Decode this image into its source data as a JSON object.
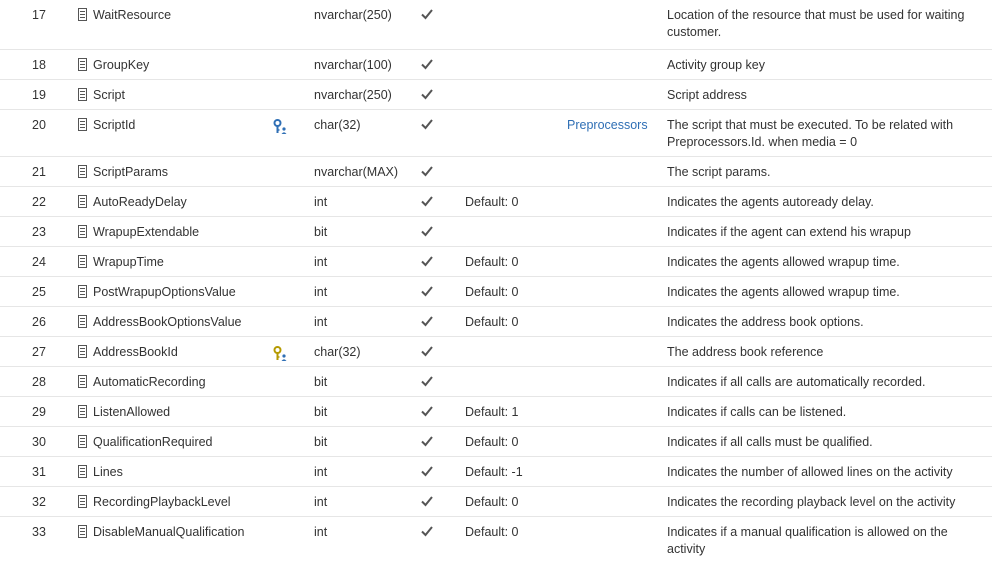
{
  "rows": [
    {
      "num": "17",
      "name": "WaitResource",
      "type": "nvarchar(250)",
      "nullable": true,
      "key": "",
      "default": "",
      "ref": "",
      "desc": "Location of the resource that must be used for waiting customer."
    },
    {
      "num": "18",
      "name": "GroupKey",
      "type": "nvarchar(100)",
      "nullable": true,
      "key": "",
      "default": "",
      "ref": "",
      "desc": "Activity group key"
    },
    {
      "num": "19",
      "name": "Script",
      "type": "nvarchar(250)",
      "nullable": true,
      "key": "",
      "default": "",
      "ref": "",
      "desc": "Script address"
    },
    {
      "num": "20",
      "name": "ScriptId",
      "type": "char(32)",
      "nullable": true,
      "key": "blue",
      "default": "",
      "ref": "Preprocessors",
      "desc": "The script that must be executed. To be related with Preprocessors.Id. when media = 0"
    },
    {
      "num": "21",
      "name": "ScriptParams",
      "type": "nvarchar(MAX)",
      "nullable": true,
      "key": "",
      "default": "",
      "ref": "",
      "desc": "The script params."
    },
    {
      "num": "22",
      "name": "AutoReadyDelay",
      "type": "int",
      "nullable": true,
      "key": "",
      "default": "Default: 0",
      "ref": "",
      "desc": "Indicates the agents autoready delay."
    },
    {
      "num": "23",
      "name": "WrapupExtendable",
      "type": "bit",
      "nullable": true,
      "key": "",
      "default": "",
      "ref": "",
      "desc": "Indicates if the agent can extend his wrapup"
    },
    {
      "num": "24",
      "name": "WrapupTime",
      "type": "int",
      "nullable": true,
      "key": "",
      "default": "Default: 0",
      "ref": "",
      "desc": "Indicates the agents allowed wrapup time."
    },
    {
      "num": "25",
      "name": "PostWrapupOptionsValue",
      "type": "int",
      "nullable": true,
      "key": "",
      "default": "Default: 0",
      "ref": "",
      "desc": "Indicates the agents allowed wrapup time."
    },
    {
      "num": "26",
      "name": "AddressBookOptionsValue",
      "type": "int",
      "nullable": true,
      "key": "",
      "default": "Default: 0",
      "ref": "",
      "desc": "Indicates the address book options."
    },
    {
      "num": "27",
      "name": "AddressBookId",
      "type": "char(32)",
      "nullable": true,
      "key": "gold",
      "default": "",
      "ref": "",
      "desc": "The address book reference"
    },
    {
      "num": "28",
      "name": "AutomaticRecording",
      "type": "bit",
      "nullable": true,
      "key": "",
      "default": "",
      "ref": "",
      "desc": "Indicates if all calls are automatically recorded."
    },
    {
      "num": "29",
      "name": "ListenAllowed",
      "type": "bit",
      "nullable": true,
      "key": "",
      "default": "Default: 1",
      "ref": "",
      "desc": "Indicates if calls can be listened."
    },
    {
      "num": "30",
      "name": "QualificationRequired",
      "type": "bit",
      "nullable": true,
      "key": "",
      "default": "Default: 0",
      "ref": "",
      "desc": "Indicates if all calls must be qualified."
    },
    {
      "num": "31",
      "name": "Lines",
      "type": "int",
      "nullable": true,
      "key": "",
      "default": "Default: -1",
      "ref": "",
      "desc": "Indicates the number of allowed lines on the activity"
    },
    {
      "num": "32",
      "name": "RecordingPlaybackLevel",
      "type": "int",
      "nullable": true,
      "key": "",
      "default": "Default: 0",
      "ref": "",
      "desc": "Indicates the recording playback level on the activity"
    },
    {
      "num": "33",
      "name": "DisableManualQualification",
      "type": "int",
      "nullable": true,
      "key": "",
      "default": "Default: 0",
      "ref": "",
      "desc": "Indicates if a manual qualification is allowed on the activity"
    }
  ],
  "colors": {
    "link": "#2f6fb5",
    "check": "#555555",
    "key_blue": "#2f6fb5",
    "key_gold": "#b59a00",
    "border": "#e6e6e6"
  },
  "icons": {
    "column": "column-icon",
    "nullable": "checkmark-icon",
    "key": "key-icon"
  }
}
